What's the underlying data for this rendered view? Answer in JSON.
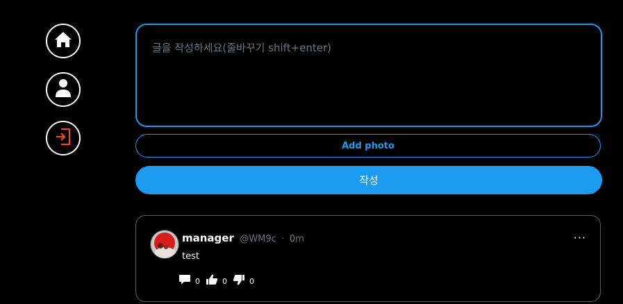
{
  "composer": {
    "placeholder": "글을 작성하세요(줄바꾸기 shift+enter)",
    "add_photo_label": "Add photo",
    "submit_label": "작성"
  },
  "colors": {
    "accent": "#1d9bf0",
    "logout": "#f04a24",
    "background": "#000000"
  },
  "nav": {
    "items": [
      {
        "icon": "home-icon"
      },
      {
        "icon": "user-icon"
      },
      {
        "icon": "logout-icon"
      }
    ]
  },
  "post": {
    "author_name": "manager",
    "author_handle": "@WM9c",
    "separator": "·",
    "time": "0m",
    "more_label": "···",
    "text": "test",
    "comments_count": "0",
    "likes_count": "0",
    "dislikes_count": "0"
  }
}
